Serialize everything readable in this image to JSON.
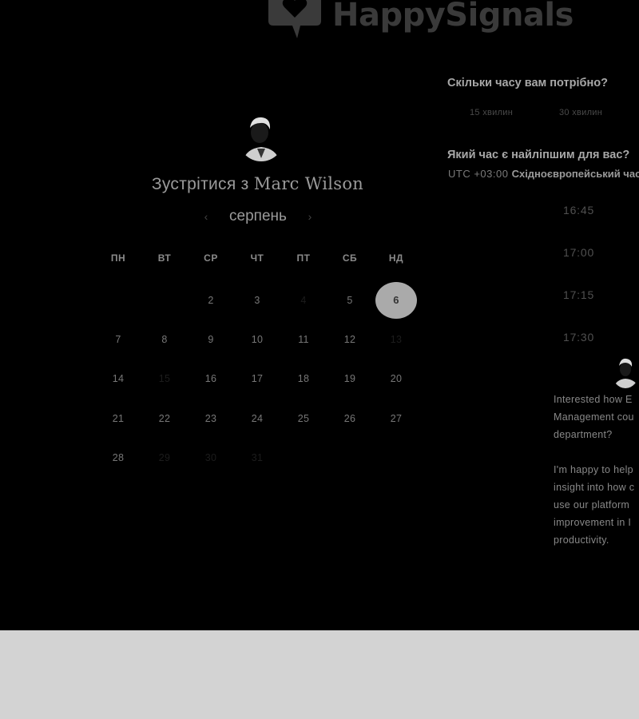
{
  "brand": {
    "name": "HappySignals"
  },
  "organizer": {
    "prefix": "Зустрітися з",
    "name": "Marc Wilson"
  },
  "calendar": {
    "month": "серпень",
    "prev_icon": "chevron-left-icon",
    "next_icon": "chevron-right-icon",
    "weekdays": [
      "ПН",
      "ВТ",
      "СР",
      "ЧТ",
      "ПТ",
      "СБ",
      "НД"
    ],
    "days": [
      {
        "d": "",
        "state": "blank"
      },
      {
        "d": "",
        "state": "blank"
      },
      {
        "d": "2",
        "state": "available"
      },
      {
        "d": "3",
        "state": "available"
      },
      {
        "d": "4",
        "state": "faint"
      },
      {
        "d": "5",
        "state": "available"
      },
      {
        "d": "6",
        "state": "selected"
      },
      {
        "d": "7",
        "state": "available"
      },
      {
        "d": "8",
        "state": "available"
      },
      {
        "d": "9",
        "state": "available"
      },
      {
        "d": "10",
        "state": "available"
      },
      {
        "d": "11",
        "state": "available"
      },
      {
        "d": "12",
        "state": "available"
      },
      {
        "d": "13",
        "state": "faint"
      },
      {
        "d": "14",
        "state": "available"
      },
      {
        "d": "15",
        "state": "faint"
      },
      {
        "d": "16",
        "state": "available"
      },
      {
        "d": "17",
        "state": "available"
      },
      {
        "d": "18",
        "state": "available"
      },
      {
        "d": "19",
        "state": "available"
      },
      {
        "d": "20",
        "state": "available"
      },
      {
        "d": "21",
        "state": "available"
      },
      {
        "d": "22",
        "state": "available"
      },
      {
        "d": "23",
        "state": "available"
      },
      {
        "d": "24",
        "state": "available"
      },
      {
        "d": "25",
        "state": "available"
      },
      {
        "d": "26",
        "state": "available"
      },
      {
        "d": "27",
        "state": "available"
      },
      {
        "d": "28",
        "state": "available"
      },
      {
        "d": "29",
        "state": "faint"
      },
      {
        "d": "30",
        "state": "faint"
      },
      {
        "d": "31",
        "state": "faint"
      },
      {
        "d": "",
        "state": "blank"
      },
      {
        "d": "",
        "state": "blank"
      },
      {
        "d": "",
        "state": "blank"
      }
    ]
  },
  "duration": {
    "question": "Скільки часу вам потрібно?",
    "options": [
      "15 хвилин",
      "30 хвилин"
    ]
  },
  "time": {
    "question": "Який час є найліпшим для вас?",
    "tz_offset": "UTC +03:00",
    "tz_name": "Східноєвропейський час",
    "slots": [
      "16:45",
      "17:00",
      "17:15",
      "17:30"
    ]
  },
  "bio": {
    "lines": [
      "Interested how E",
      "Management cou",
      "department?",
      "",
      "I'm happy to help",
      "insight into how c",
      "use our platform",
      "improvement in I",
      "productivity."
    ]
  },
  "colors": {
    "background": "#000000",
    "selected_day": "#aaaaaa",
    "footer": "#d3d3d3"
  }
}
